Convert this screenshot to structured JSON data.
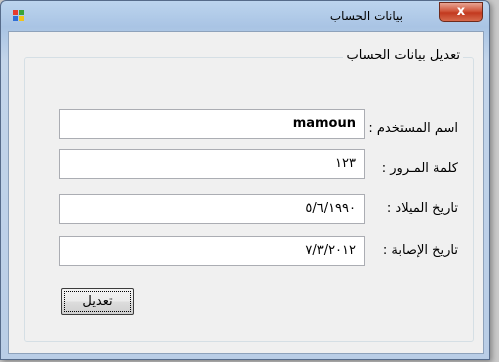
{
  "window": {
    "title": "بيانات الحساب",
    "close_glyph": "x"
  },
  "group": {
    "title": "تعديل بيانات الحساب"
  },
  "fields": [
    {
      "label": "اسم المستخدم :",
      "value": "mamoun"
    },
    {
      "label": "كلمة المـرور :",
      "value": "١٢٣"
    },
    {
      "label": "تاريخ الميلاد :",
      "value": "٥/٦/١٩٩٠"
    },
    {
      "label": "تاريخ الإصابة :",
      "value": "٧/٣/٢٠١٢"
    }
  ],
  "edit_button": {
    "label": "تعديل"
  },
  "colors": {
    "titlebar": "#b9cde6",
    "close": "#c2391f",
    "client": "#f0f0f0"
  }
}
